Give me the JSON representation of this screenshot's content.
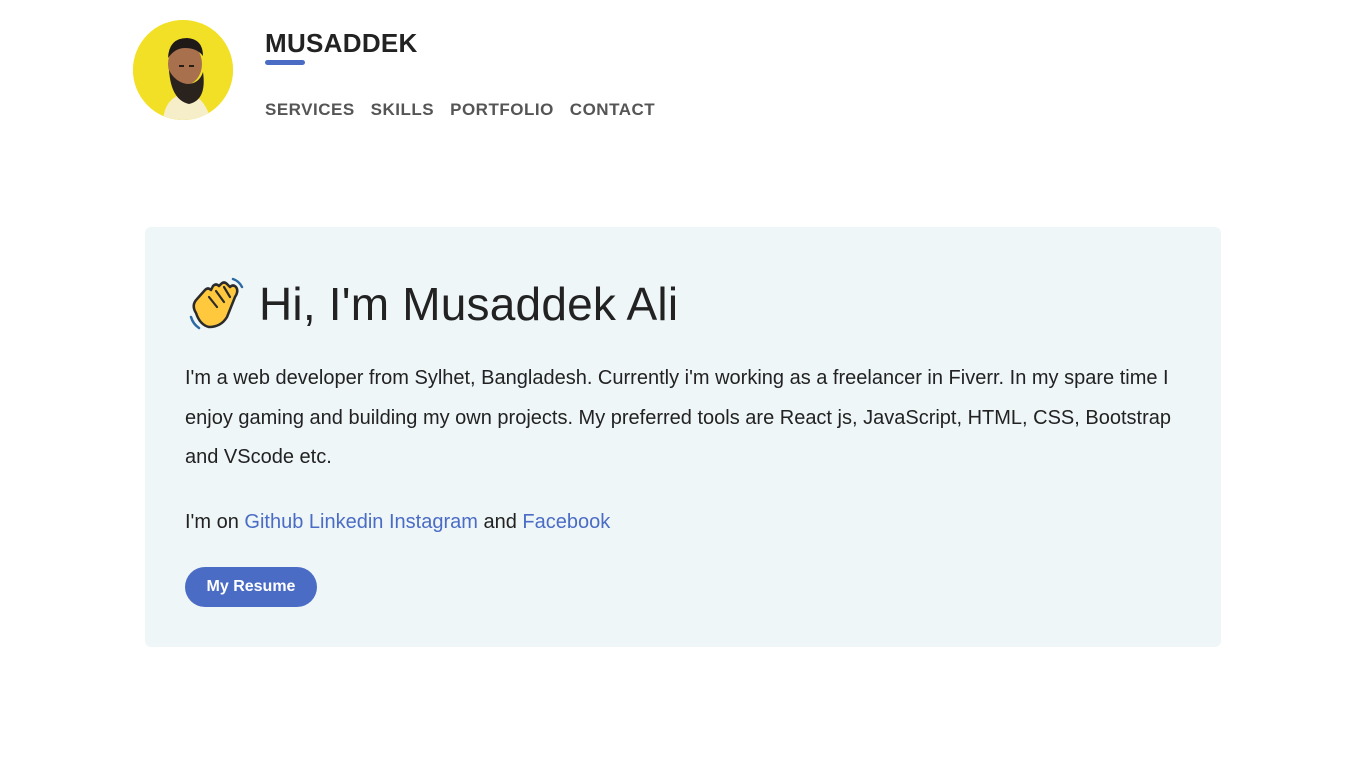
{
  "header": {
    "brand": "MUSADDEK",
    "nav": [
      "SERVICES",
      "SKILLS",
      "PORTFOLIO",
      "CONTACT"
    ]
  },
  "hero": {
    "wave_icon": "waving-hand-icon",
    "title": "Hi, I'm Musaddek Ali",
    "bio": "I'm a web developer from Sylhet, Bangladesh. Currently i'm working as a freelancer in Fiverr. In my spare time I enjoy gaming and building my own projects. My preferred tools are React js, JavaScript, HTML, CSS, Bootstrap and VScode etc.",
    "social_prefix": "I'm on",
    "links": [
      "Github",
      "Linkedin",
      "Instagram"
    ],
    "social_joiner": "and",
    "last_link": "Facebook",
    "resume_label": "My Resume"
  },
  "colors": {
    "accent": "#4a6cc5",
    "card_bg": "#eff6f8",
    "avatar_bg": "#f2e027"
  }
}
